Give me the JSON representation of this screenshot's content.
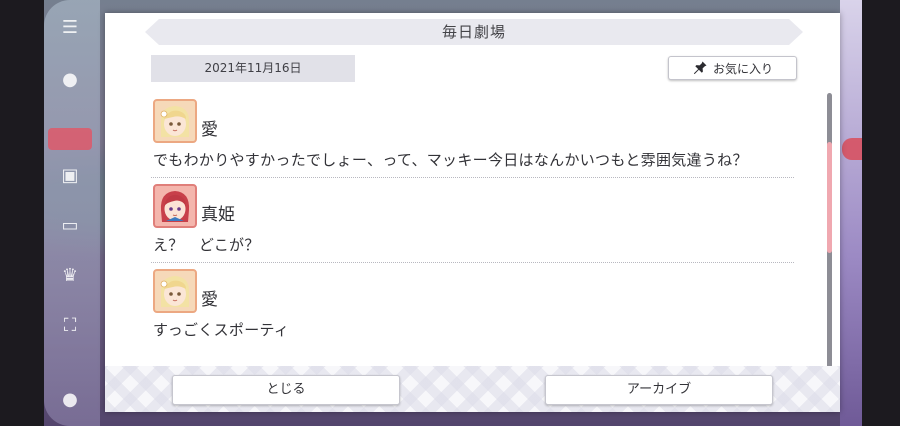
{
  "dialog": {
    "title": "毎日劇場",
    "date": "2021年11月16日",
    "favorite_label": "お気に入り"
  },
  "messages": [
    {
      "speaker": "愛",
      "avatar_icon": "ai-avatar-icon",
      "text": "でもわかりやすかったでしょー、って、マッキー今日はなんかいつもと雰囲気違うね？"
    },
    {
      "speaker": "真姫",
      "avatar_icon": "maki-avatar-icon",
      "text": "え？　どこが？"
    },
    {
      "speaker": "愛",
      "avatar_icon": "ai-avatar-icon",
      "text": "すっごくスポーティ"
    }
  ],
  "footer": {
    "close_label": "とじる",
    "archive_label": "アーカイブ"
  },
  "colors": {
    "scroll_thumb": "#f0a8b0",
    "title_band": "#e9e9ef",
    "date_chip": "#e1e1e8"
  }
}
